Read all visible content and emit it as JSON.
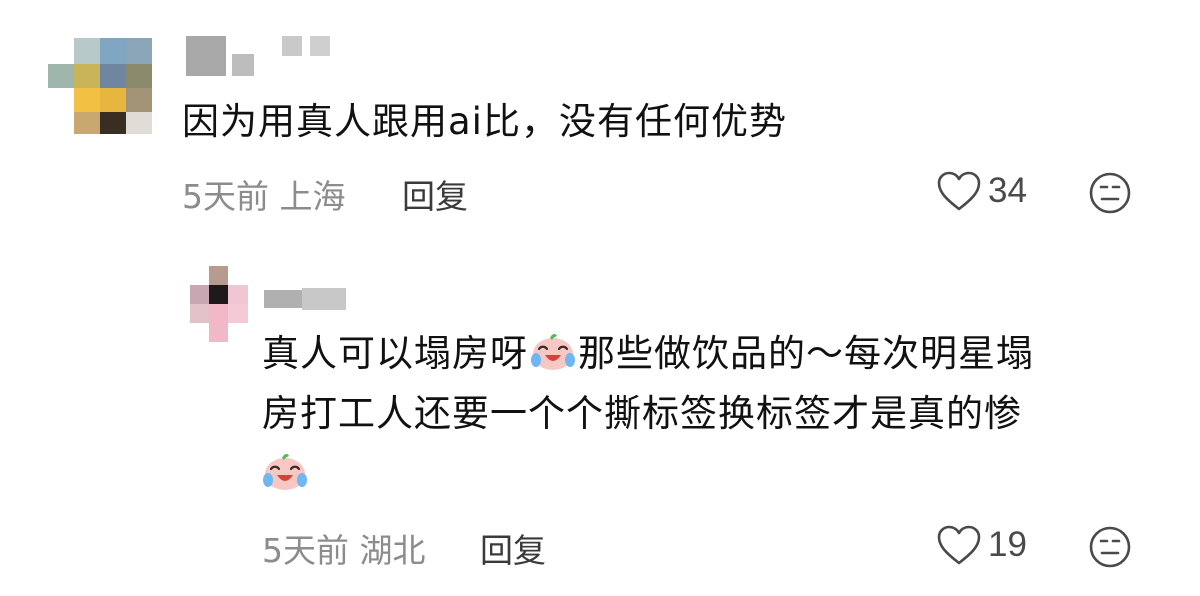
{
  "comments": [
    {
      "text_line1": "因为用真人跟用ai比，没有任何优势",
      "time": "5天前",
      "location": "上海",
      "reply_label": "回复",
      "likes": "34"
    },
    {
      "text_line1_a": "真人可以塌房呀",
      "text_line1_b": "那些做饮品的～每次明星塌",
      "text_line2": "房打工人还要一个个撕标签换标签才是真的惨",
      "time": "5天前",
      "location": "湖北",
      "reply_label": "回复",
      "likes": "19"
    }
  ],
  "icons": {
    "like": "heart-outline-icon",
    "dislike": "frown-face-icon",
    "emoji": "crying-laughing-peach-emoji"
  },
  "colors": {
    "meta_text": "#8c8c8c",
    "body_text": "#111111",
    "icon": "#4a4a4a"
  }
}
